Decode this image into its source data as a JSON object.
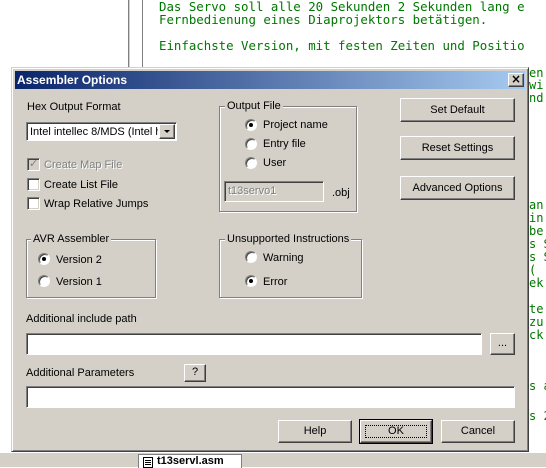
{
  "background": {
    "code_lines": [
      "Das Servo soll alle 20 Sekunden 2 Sekunden lang e",
      "Fernbedienung eines Diaprojektors betätigen.",
      "",
      "Einfachste Version, mit festen Zeiten und Positio"
    ],
    "right_fragments": [
      "en",
      "wi",
      "nd",
      "",
      "",
      "",
      "",
      "",
      "",
      "",
      "an",
      "in",
      "be",
      "s S",
      "s S",
      "(",
      "ek",
      "",
      "te",
      "zu",
      "ck",
      "",
      "",
      "",
      "s a",
      "",
      "s 2"
    ],
    "taskbar_item": "t13servl.asm"
  },
  "dialog": {
    "title": "Assembler Options",
    "close_glyph": "×",
    "hex_output_format": {
      "label": "Hex Output Format",
      "selected": "Intel intellec 8/MDS (Intel h"
    },
    "checkboxes": {
      "create_map_file": {
        "label": "Create Map File",
        "checked": true,
        "enabled": false
      },
      "create_list_file": {
        "label": "Create List File",
        "checked": false,
        "enabled": true
      },
      "wrap_relative_jumps": {
        "label": "Wrap Relative Jumps",
        "checked": false,
        "enabled": true
      }
    },
    "output_file": {
      "label": "Output File",
      "options": [
        "Project name",
        "Entry file",
        "User"
      ],
      "selected": "Project name",
      "filename": "t13servo1",
      "extension": ".obj"
    },
    "avr_assembler": {
      "label": "AVR Assembler",
      "options": [
        "Version 2",
        "Version 1"
      ],
      "selected": "Version 2"
    },
    "unsupported_instructions": {
      "label": "Unsupported Instructions",
      "options": [
        "Warning",
        "Error"
      ],
      "selected": "Error"
    },
    "buttons": {
      "set_default": "Set Default",
      "reset_settings": "Reset Settings",
      "advanced_options": "Advanced Options",
      "browse": "...",
      "help_q": "?",
      "help": "Help",
      "ok": "OK",
      "cancel": "Cancel"
    },
    "additional_include_path": {
      "label": "Additional include path",
      "value": ""
    },
    "additional_parameters": {
      "label": "Additional Parameters",
      "value": ""
    }
  },
  "colors": {
    "title_gradient_start": "#0a246a",
    "title_gradient_end": "#a6caf0",
    "dialog_face": "#d4d0c8",
    "code_text": "#007700"
  }
}
